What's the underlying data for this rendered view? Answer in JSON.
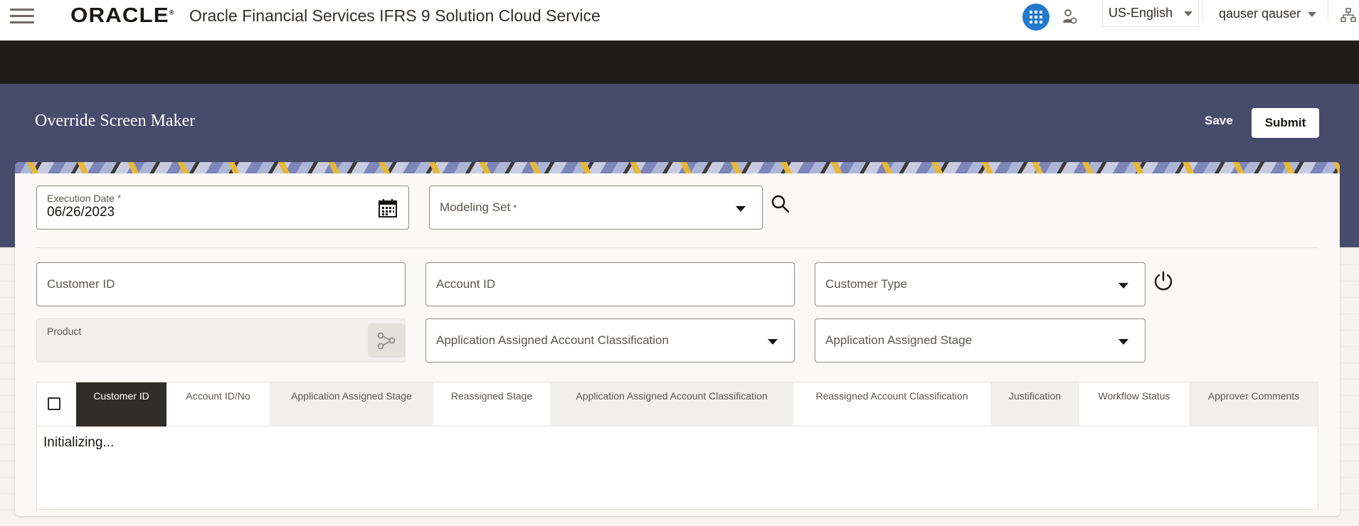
{
  "header": {
    "logo_text": "ORACLE",
    "logo_mark": "®",
    "app_title": "Oracle Financial Services IFRS 9 Solution Cloud Service",
    "language": "US-English",
    "user": "qauser qauser",
    "icons": [
      "hamburger-menu-icon",
      "app-grid-icon",
      "user-role-icon",
      "hierarchy-icon"
    ],
    "accent_color": "#227acb"
  },
  "page": {
    "title": "Override Screen Maker",
    "save_label": "Save",
    "submit_label": "Submit",
    "title_band_color": "#474c6c"
  },
  "filters": {
    "execution_date": {
      "label": "Execution Date",
      "required": "*",
      "value": "06/26/2023"
    },
    "modeling_set": {
      "label": "Modeling Set",
      "required": "*"
    },
    "customer_id": {
      "label": "Customer ID"
    },
    "account_id": {
      "label": "Account ID"
    },
    "customer_type": {
      "label": "Customer Type"
    },
    "product": {
      "label": "Product"
    },
    "app_account_classification": {
      "label": "Application Assigned Account Classification"
    },
    "app_stage": {
      "label": "Application Assigned Stage"
    }
  },
  "table": {
    "columns": [
      "Customer ID",
      "Account ID/No",
      "Application Assigned Stage",
      "Reassigned Stage",
      "Application Assigned Account Classification",
      "Reassigned Account Classification",
      "Justification",
      "Workflow Status",
      "Approver Comments"
    ],
    "status_text": "Initializing..."
  }
}
